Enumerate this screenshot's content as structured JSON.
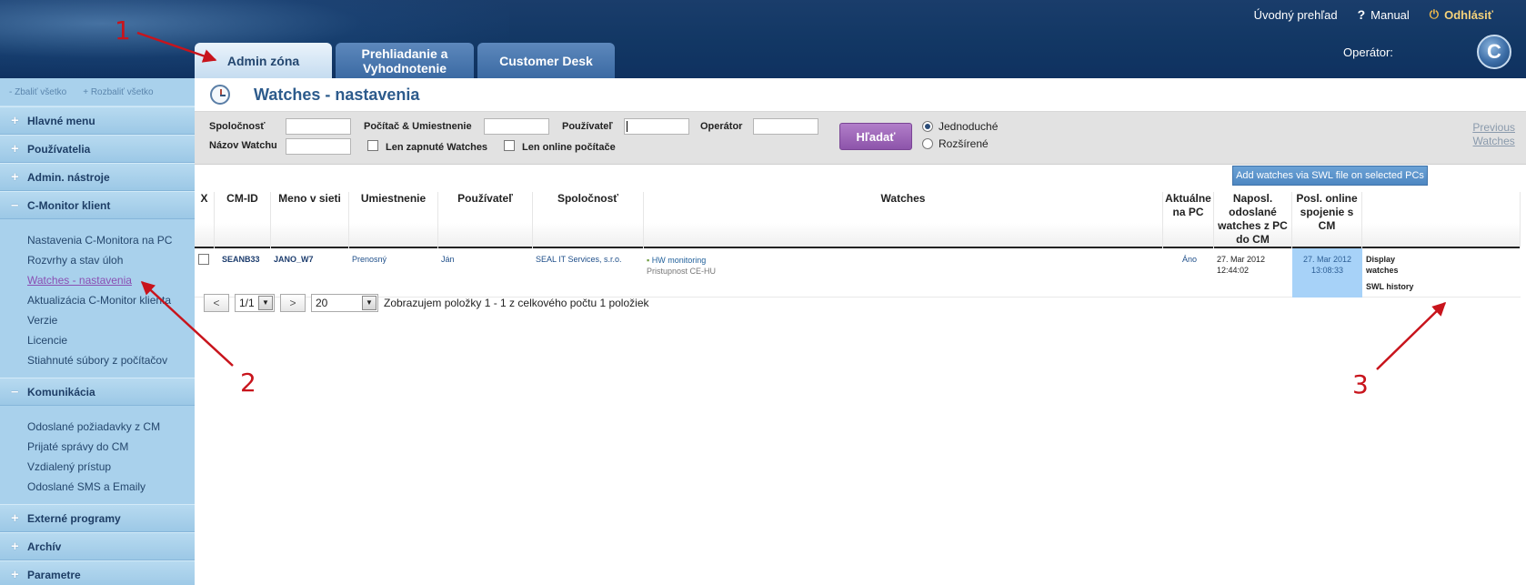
{
  "header": {
    "top_links": {
      "overview": "Úvodný prehľad",
      "manual": "Manual",
      "logout": "Odhlásiť"
    },
    "operator_label": "Operátor:",
    "logo_letter": "C",
    "tabs": [
      {
        "label": "Admin zóna",
        "active": true
      },
      {
        "label": "Prehliadanie a Vyhodnotenie",
        "active": false
      },
      {
        "label": "Customer Desk",
        "active": false
      }
    ]
  },
  "sidebar": {
    "collapse_all": "- Zbaliť všetko",
    "expand_all": "+ Rozbaliť všetko",
    "sections": [
      {
        "label": "Hlavné menu",
        "sign": "+",
        "items": []
      },
      {
        "label": "Používatelia",
        "sign": "+",
        "items": []
      },
      {
        "label": "Admin. nástroje",
        "sign": "+",
        "items": []
      },
      {
        "label": "C-Monitor klient",
        "sign": "–",
        "items": [
          "Nastavenia C-Monitora na PC",
          "Rozvrhy a stav úloh",
          "Watches - nastavenia",
          "Aktualizácia C-Monitor klienta",
          "Verzie",
          "Licencie",
          "Stiahnuté súbory z počítačov"
        ]
      },
      {
        "label": "Komunikácia",
        "sign": "–",
        "items": [
          "Odoslané požiadavky z CM",
          "Prijaté správy do CM",
          "Vzdialený prístup",
          "Odoslané SMS a Emaily"
        ]
      },
      {
        "label": "Externé programy",
        "sign": "+",
        "items": []
      },
      {
        "label": "Archív",
        "sign": "+",
        "items": []
      },
      {
        "label": "Parametre",
        "sign": "+",
        "items": []
      }
    ],
    "current_item": "Watches - nastavenia"
  },
  "page": {
    "title": "Watches - nastavenia"
  },
  "filter": {
    "company_label": "Spoločnosť",
    "pc_label": "Počítač & Umiestnenie",
    "user_label": "Používateľ",
    "operator_label": "Operátor",
    "watch_name_label": "Názov Watchu",
    "only_enabled_label": "Len zapnuté Watches",
    "only_online_label": "Len online počítače",
    "search_button": "Hľadať",
    "mode_simple": "Jednoduché",
    "mode_extended": "Rozšírené",
    "previous_watches_1": "Previous",
    "previous_watches_2": "Watches"
  },
  "actions": {
    "add_swl": "Add watches via SWL file on selected PCs"
  },
  "table": {
    "columns": [
      "X",
      "CM-ID",
      "Meno v sieti",
      "Umiestnenie",
      "Používateľ",
      "Spoločnosť",
      "Watches",
      "Aktuálne na PC",
      "Naposl. odoslané watches z PC do CM",
      "Posl. online spojenie s CM",
      ""
    ],
    "rows": [
      {
        "cm_id": "SEANB33",
        "network_name": "JANO_W7",
        "location": "Prenosný",
        "user": "Ján",
        "company": "SEAL IT Services, s.r.o.",
        "watch_name": "HW monitoring",
        "watch_detail": "Pristupnost CE-HU",
        "current_on_pc": "Áno",
        "last_sent_date": "27. Mar 2012",
        "last_sent_time": "12:44:02",
        "last_online_date": "27. Mar 2012",
        "last_online_time": "13:08:33",
        "display_watches_1": "Display",
        "display_watches_2": "watches",
        "swl_history": "SWL history"
      }
    ]
  },
  "pager": {
    "prev": "<",
    "page": "1/1",
    "next": ">",
    "page_size": "20",
    "summary": "Zobrazujem položky 1 - 1 z celkového počtu 1 položiek"
  },
  "annotations": [
    "1",
    "2",
    "3"
  ]
}
